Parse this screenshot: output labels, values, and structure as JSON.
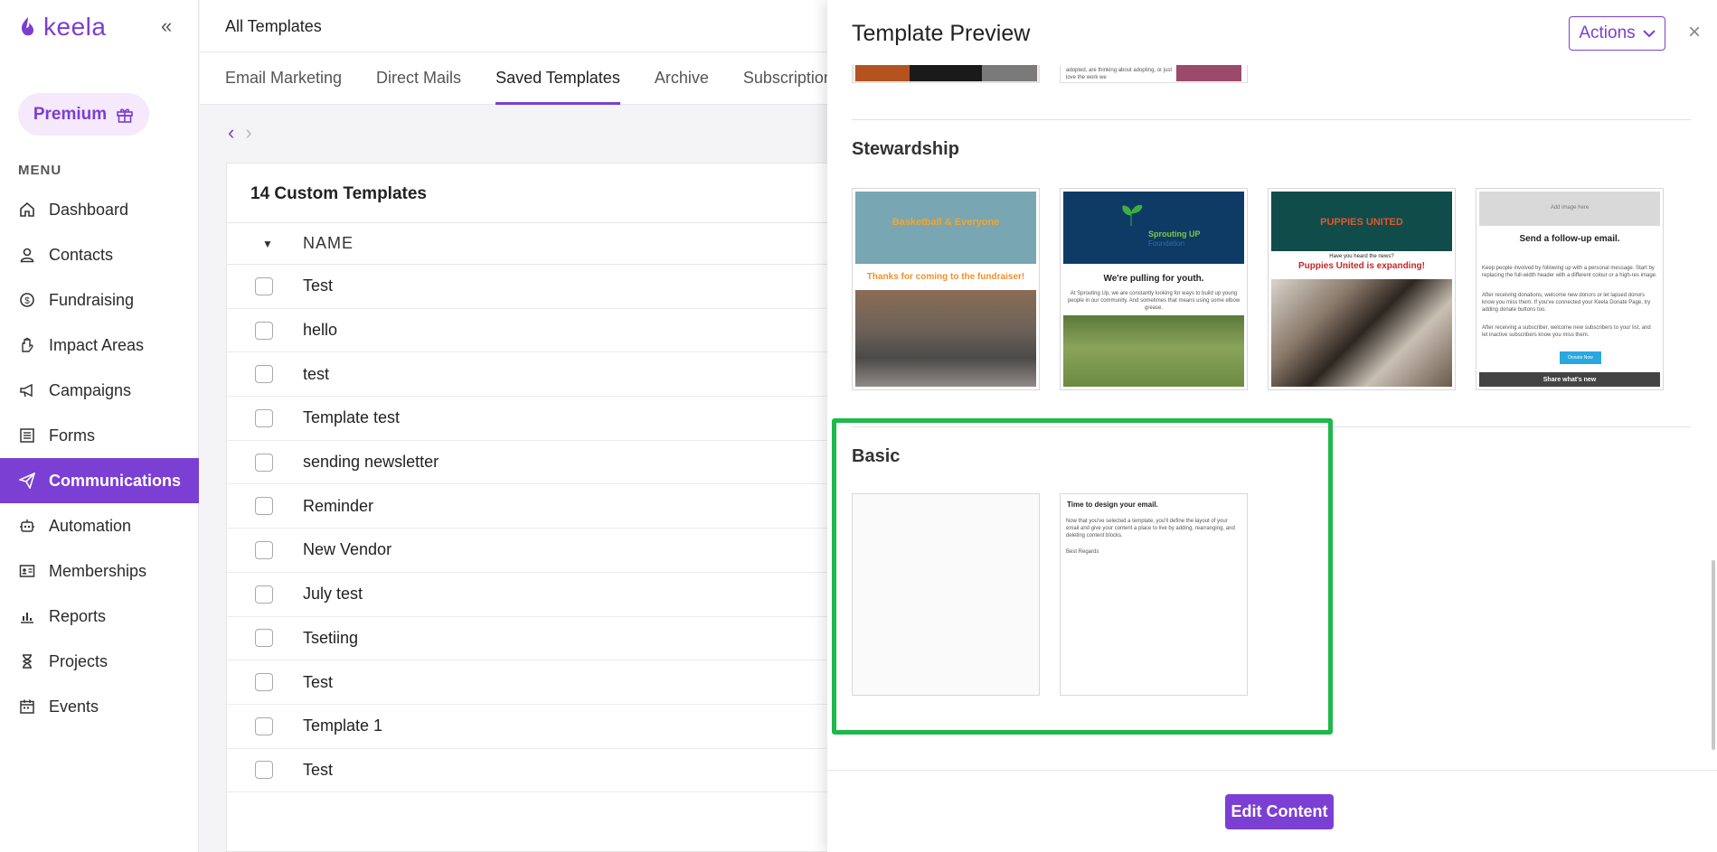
{
  "brand": {
    "name": "keela",
    "color": "#7a3fd1"
  },
  "sidebar": {
    "premium_label": "Premium",
    "menu_label": "MENU",
    "items": [
      {
        "label": "Dashboard",
        "icon": "home-icon"
      },
      {
        "label": "Contacts",
        "icon": "person-icon"
      },
      {
        "label": "Fundraising",
        "icon": "money-icon"
      },
      {
        "label": "Impact Areas",
        "icon": "hand-icon"
      },
      {
        "label": "Campaigns",
        "icon": "megaphone-icon"
      },
      {
        "label": "Forms",
        "icon": "list-icon"
      },
      {
        "label": "Communications",
        "icon": "send-icon",
        "active": true
      },
      {
        "label": "Automation",
        "icon": "robot-icon"
      },
      {
        "label": "Memberships",
        "icon": "id-card-icon"
      },
      {
        "label": "Reports",
        "icon": "chart-icon"
      },
      {
        "label": "Projects",
        "icon": "hourglass-icon"
      },
      {
        "label": "Events",
        "icon": "calendar-icon"
      }
    ]
  },
  "header": {
    "title": "All Templates"
  },
  "tabs": [
    "Email Marketing",
    "Direct Mails",
    "Saved Templates",
    "Archive",
    "Subscription"
  ],
  "active_tab": "Saved Templates",
  "templates_card": {
    "title": "14 Custom Templates",
    "column_name": "NAME",
    "rows": [
      "Test",
      "hello",
      "test",
      "Template test",
      "sending newsletter",
      "Reminder",
      "New Vendor",
      "July test",
      "Tsetiing",
      "Test",
      "Template 1",
      "Test"
    ]
  },
  "drawer": {
    "title": "Template Preview",
    "actions_label": "Actions",
    "prev_snippet": "adopted, are thinking about adopting, or just love the work we",
    "stewardship": {
      "title": "Stewardship",
      "thumbs": {
        "t1": {
          "logo": "Basketball & Everyone",
          "headline": "Thanks for coming to the fundraiser!"
        },
        "t2": {
          "logo": "Sprouting UP",
          "logo_sub": "Foundation",
          "headline": "We're pulling for youth.",
          "body": "At Sprouting Up, we are constantly looking for ways to build up young people in our community. And sometimes that means using some elbow grease."
        },
        "t3": {
          "logo": "PUPPIES UNITED",
          "kicker": "Have you heard the news?",
          "headline": "Puppies United is expanding!"
        },
        "t4": {
          "img_placeholder": "Add image here",
          "headline": "Send a follow-up email.",
          "body1": "Keep people involved by following up with a personal message. Start by replacing the full-width header with a different colour or a high-res image.",
          "body2": "After receiving donations, welcome new donors or let lapsed donors know you miss them. If you've connected your Keela Donate Page, try adding donate buttons too.",
          "body3": "After receiving a subscriber, welcome new subscribers to your list, and let inactive subscribers know you miss them.",
          "button": "Donate Now",
          "footer": "Share what's new"
        }
      }
    },
    "basic": {
      "title": "Basic",
      "thumb2": {
        "headline": "Time to design your email.",
        "body": "Now that you've selected a template, you'll define the layout of your email and give your content a place to live by adding, rearranging, and deleting content blocks.",
        "signoff": "Best Regards"
      }
    },
    "edit_label": "Edit Content"
  },
  "colors": {
    "accent": "#7b3fd4",
    "highlight": "#1fb84a"
  }
}
